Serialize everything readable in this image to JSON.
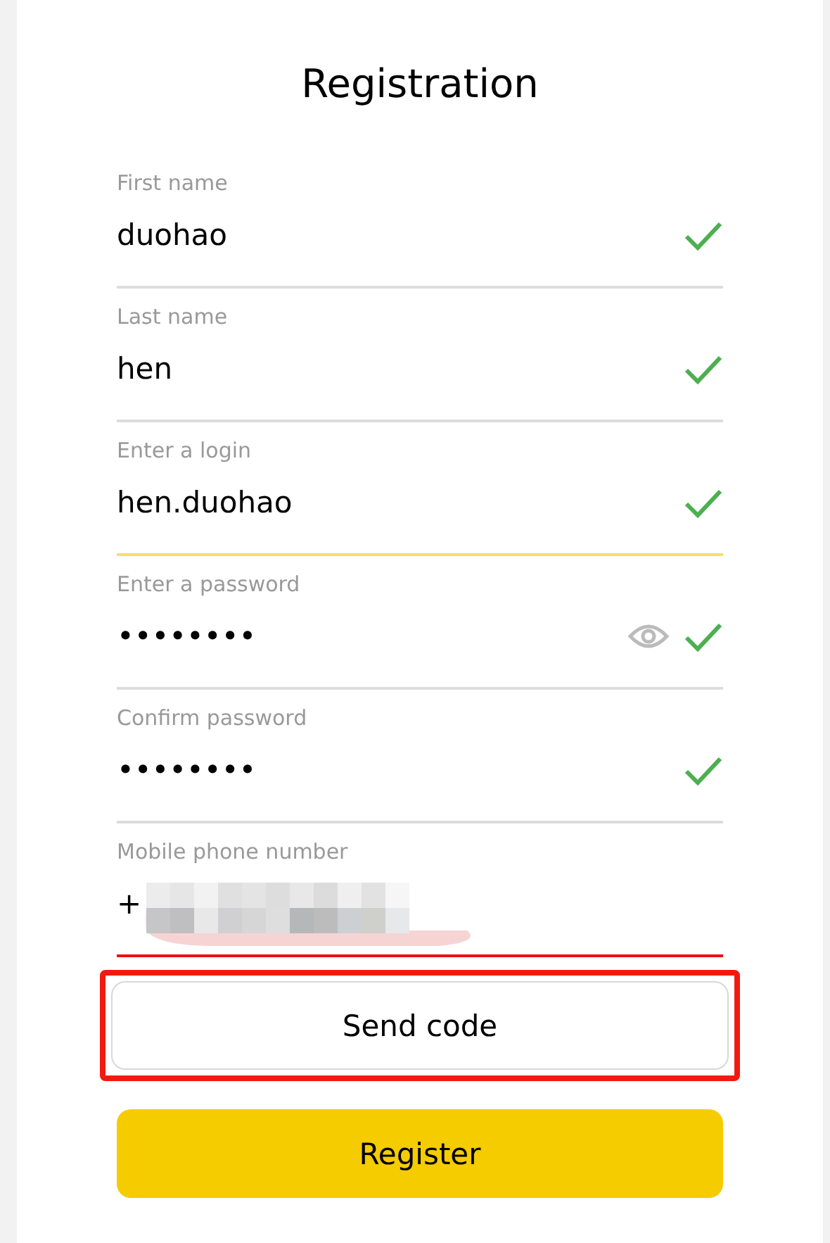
{
  "title": "Registration",
  "fields": [
    {
      "label": "First name",
      "value": "duohao",
      "valid": true,
      "focused": false,
      "error": false
    },
    {
      "label": "Last name",
      "value": "hen",
      "valid": true,
      "focused": false,
      "error": false
    },
    {
      "label": "Enter a login",
      "value": "hen.duohao",
      "valid": true,
      "focused": true,
      "error": false
    },
    {
      "label": "Enter a password",
      "value": "••••••••",
      "valid": true,
      "focused": false,
      "error": false,
      "reveal": true
    },
    {
      "label": "Confirm password",
      "value": "••••••••",
      "valid": true,
      "focused": false,
      "error": false
    },
    {
      "label": "Mobile phone number",
      "value": "+",
      "valid": false,
      "focused": false,
      "error": true,
      "redacted": true
    }
  ],
  "send_button": {
    "label": "Send code",
    "highlighted": true
  },
  "register_button": {
    "label": "Register"
  }
}
